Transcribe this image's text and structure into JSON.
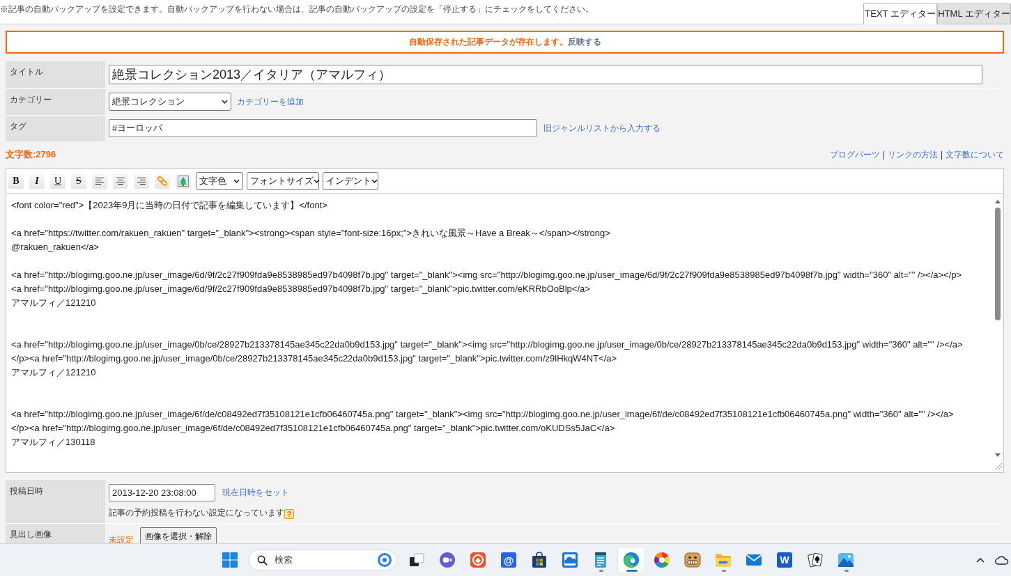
{
  "top_bar": {
    "notice": "※記事の自動バックアップを設定できます。自動バックアップを行わない場合は、記事の自動バックアップの設定を「停止する」にチェックをしてください。",
    "tabs": [
      {
        "label": "TEXT エディター",
        "selected": true
      },
      {
        "label": "HTML エディター",
        "selected": false
      }
    ]
  },
  "autosave_alert": {
    "message": "自動保存された記事データが存在します。",
    "link": "反映する"
  },
  "fields": [
    {
      "kind": "title",
      "label": "タイトル",
      "value": "絶景コレクション2013／イタリア（アマルフィ）"
    },
    {
      "kind": "select",
      "label": "カテゴリー",
      "value": "絶景コレクション",
      "link": "カテゴリーを追加"
    },
    {
      "kind": "tag",
      "label": "タグ",
      "value": "#ヨーロッパ",
      "link": "旧ジャンルリストから入力する"
    }
  ],
  "char_count": "文字数:2796",
  "help_links": [
    {
      "kind": "link",
      "text": "ブログパーツ"
    },
    {
      "kind": "separator",
      "text": "|"
    },
    {
      "kind": "link",
      "text": "リンクの方法"
    },
    {
      "kind": "separator",
      "text": "|"
    },
    {
      "kind": "link",
      "text": "文字数について"
    }
  ],
  "toolbar": {
    "format_buttons": [
      {
        "kind": "bold",
        "label": "B"
      },
      {
        "kind": "italic",
        "label": "I"
      },
      {
        "kind": "underline",
        "label": "U"
      },
      {
        "kind": "strike",
        "label": "S"
      }
    ],
    "selects": [
      "文字色",
      "フォントサイズ",
      "インデント"
    ]
  },
  "editor": {
    "value": "<font color=\"red\">【2023年9月に当時の日付で記事を編集しています】</font>\n\n<a href=\"https://twitter.com/rakuen_rakuen\" target=\"_blank\"><strong><span style=\"font-size:16px;\">きれいな風景～Have a Break～</span></strong>\n@rakuen_rakuen</a>\n\n<a href=\"http://blogimg.goo.ne.jp/user_image/6d/9f/2c27f909fda9e8538985ed97b4098f7b.jpg\" target=\"_blank\"><img src=\"http://blogimg.goo.ne.jp/user_image/6d/9f/2c27f909fda9e8538985ed97b4098f7b.jpg\" width=\"360\" alt=\"\" /></a></p>\n<a href=\"http://blogimg.goo.ne.jp/user_image/6d/9f/2c27f909fda9e8538985ed97b4098f7b.jpg\" target=\"_blank\">pic.twitter.com/eKRRbOoBlp</a>\nアマルフィ／121210\n\n\n<a href=\"http://blogimg.goo.ne.jp/user_image/0b/ce/28927b213378145ae345c22da0b9d153.jpg\" target=\"_blank\"><img src=\"http://blogimg.goo.ne.jp/user_image/0b/ce/28927b213378145ae345c22da0b9d153.jpg\" width=\"360\" alt=\"\" /></a>\n</p><a href=\"http://blogimg.goo.ne.jp/user_image/0b/ce/28927b213378145ae345c22da0b9d153.jpg\" target=\"_blank\">pic.twitter.com/z9lHkqW4NT</a>\nアマルフィ／121210\n\n\n<a href=\"http://blogimg.goo.ne.jp/user_image/6f/de/c08492ed7f35108121e1cfb06460745a.png\" target=\"_blank\"><img src=\"http://blogimg.goo.ne.jp/user_image/6f/de/c08492ed7f35108121e1cfb06460745a.png\" width=\"360\" alt=\"\" /></a>\n</p><a href=\"http://blogimg.goo.ne.jp/user_image/6f/de/c08492ed7f35108121e1cfb06460745a.png\" target=\"_blank\">pic.twitter.com/oKUDSs5JaC</a>\nアマルフィ／130118"
  },
  "post_fields": [
    {
      "kind": "datetime",
      "label": "投稿日時",
      "value": "2013-12-20 23:08:00",
      "link": "現在日時をセット",
      "note": "記事の予約投稿を行わない設定になっています",
      "help": "?"
    },
    {
      "kind": "image",
      "label": "見出し画像",
      "status": "未設定",
      "button": "画像を選択・解除"
    }
  ],
  "taskbar": {
    "search_placeholder": "検索",
    "apps": [
      {
        "kind": "squares",
        "running": false,
        "selected": false
      },
      {
        "kind": "camera",
        "running": false,
        "selected": false
      },
      {
        "kind": "ring",
        "running": false,
        "selected": false
      },
      {
        "kind": "at",
        "label": "@",
        "running": false,
        "selected": false
      },
      {
        "kind": "bag",
        "running": false,
        "selected": false
      },
      {
        "kind": "cloud",
        "running": false,
        "selected": false
      },
      {
        "kind": "notepad",
        "running": true,
        "selected": false
      },
      {
        "kind": "swirl",
        "running": true,
        "selected": true
      },
      {
        "kind": "aperture",
        "running": false,
        "selected": false
      },
      {
        "kind": "smiley",
        "running": false,
        "selected": false
      },
      {
        "kind": "folder",
        "running": true,
        "selected": false
      },
      {
        "kind": "envelope",
        "running": false,
        "selected": false
      },
      {
        "kind": "letter",
        "label": "W",
        "running": false,
        "selected": false
      },
      {
        "kind": "cards",
        "running": false,
        "selected": false
      },
      {
        "kind": "landscape",
        "running": true,
        "selected": false
      }
    ]
  }
}
